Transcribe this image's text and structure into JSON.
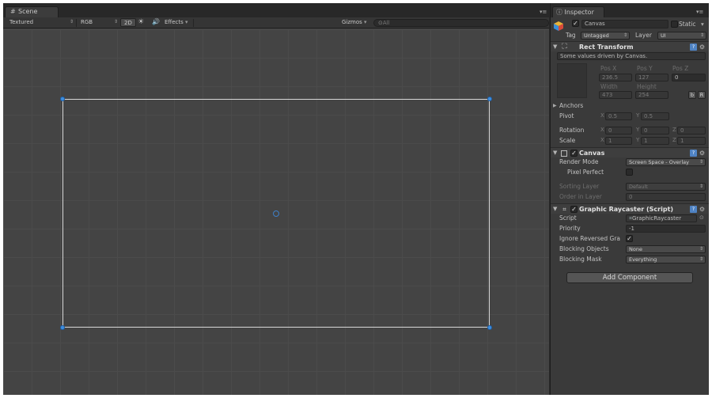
{
  "scene": {
    "tab_label": "Scene",
    "toolbar": {
      "shading_mode": "Textured",
      "render_mode": "RGB",
      "mode_2d": "2D",
      "effects_label": "Effects",
      "gizmos_label": "Gizmos",
      "search_placeholder": "All"
    }
  },
  "inspector": {
    "tab_label": "Inspector",
    "object": {
      "name": "Canvas",
      "active": true,
      "static_label": "Static",
      "static": false,
      "tag_label": "Tag",
      "tag_value": "Untagged",
      "layer_label": "Layer",
      "layer_value": "UI"
    },
    "rect_transform": {
      "title": "Rect Transform",
      "note": "Some values driven by Canvas.",
      "pos_x_label": "Pos X",
      "pos_y_label": "Pos Y",
      "pos_z_label": "Pos Z",
      "pos_x": "236.5",
      "pos_y": "127",
      "pos_z": "0",
      "width_label": "Width",
      "height_label": "Height",
      "width": "473",
      "height": "254",
      "blueprint_btn": "b",
      "raw_btn": "R",
      "anchors_label": "Anchors",
      "pivot_label": "Pivot",
      "pivot_x": "0.5",
      "pivot_y": "0.5",
      "rotation_label": "Rotation",
      "rotation_x": "0",
      "rotation_y": "0",
      "rotation_z": "0",
      "scale_label": "Scale",
      "scale_x": "1",
      "scale_y": "1",
      "scale_z": "1",
      "axis_x": "X",
      "axis_y": "Y",
      "axis_z": "Z"
    },
    "canvas": {
      "title": "Canvas",
      "enabled": true,
      "render_mode_label": "Render Mode",
      "render_mode_value": "Screen Space - Overlay",
      "pixel_perfect_label": "Pixel Perfect",
      "pixel_perfect": false,
      "sorting_layer_label": "Sorting Layer",
      "sorting_layer_value": "Default",
      "order_in_layer_label": "Order in Layer",
      "order_in_layer_value": "0"
    },
    "graphic_raycaster": {
      "title": "Graphic Raycaster (Script)",
      "enabled": true,
      "script_label": "Script",
      "script_value": "GraphicRaycaster",
      "priority_label": "Priority",
      "priority_value": "-1",
      "ignore_reversed_label": "Ignore Reversed Gra",
      "ignore_reversed": true,
      "blocking_objects_label": "Blocking Objects",
      "blocking_objects_value": "None",
      "blocking_mask_label": "Blocking Mask",
      "blocking_mask_value": "Everything"
    },
    "add_component_label": "Add Component"
  }
}
